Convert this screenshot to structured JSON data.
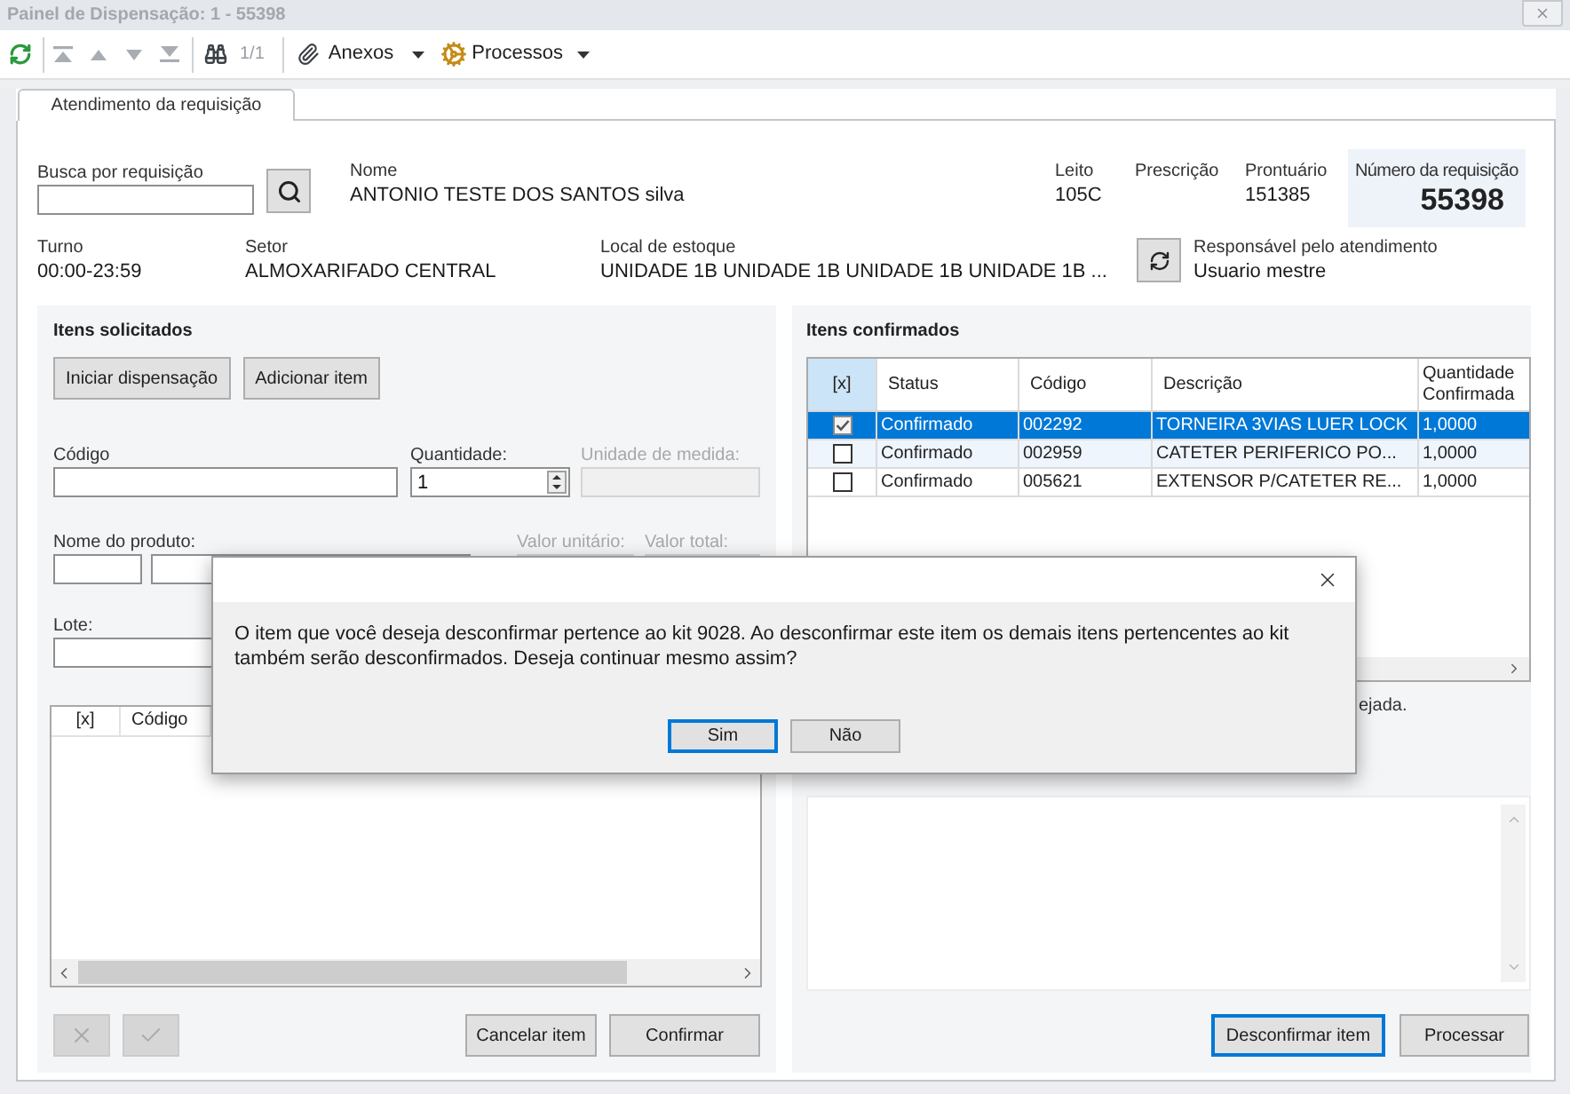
{
  "window": {
    "title": "Painel de Dispensação: 1 - 55398",
    "active": false
  },
  "toolbar": {
    "navigation": [
      {
        "kind": "first",
        "disabled": true
      },
      {
        "kind": "previous",
        "disabled": true
      },
      {
        "kind": "next",
        "disabled": true
      },
      {
        "kind": "last",
        "disabled": true
      }
    ],
    "record_counter": "1/1",
    "menus": [
      {
        "kind": "attachments",
        "label": "Anexos"
      },
      {
        "kind": "processes",
        "label": "Processos"
      }
    ]
  },
  "tabs": [
    {
      "label": "Atendimento da requisição",
      "selected": true
    }
  ],
  "request_header": {
    "search": {
      "label": "Busca por requisição"
    },
    "patient": {
      "label": "Nome",
      "value": "ANTONIO TESTE DOS SANTOS silva"
    },
    "bed": {
      "label": "Leito",
      "value": "105C"
    },
    "prescription": {
      "label": "Prescrição"
    },
    "medical_record": {
      "label": "Prontuário",
      "value": "151385"
    },
    "request_number": {
      "label": "Número da requisição",
      "value": "55398"
    },
    "shift": {
      "label": "Turno",
      "value": "00:00-23:59"
    },
    "sector": {
      "label": "Setor",
      "value": "ALMOXARIFADO CENTRAL"
    },
    "stock_location": {
      "label": "Local de estoque",
      "value": "UNIDADE 1B UNIDADE 1B UNIDADE 1B UNIDADE 1B ..."
    },
    "responsible": {
      "label": "Responsável pelo atendimento",
      "value": "Usuario mestre"
    }
  },
  "requested_items": {
    "title": "Itens solicitados",
    "actions": [
      {
        "label": "Iniciar dispensação"
      },
      {
        "label": "Adicionar item"
      }
    ],
    "form_rows": [
      [
        {
          "kind": "text",
          "label": "Código",
          "disabled": false
        },
        {
          "kind": "spin",
          "label": "Quantidade:",
          "value": "1",
          "disabled": false
        },
        {
          "kind": "text",
          "label": "Unidade de medida:",
          "disabled": true
        }
      ],
      [
        {
          "kind": "product",
          "label": "Nome do produto:",
          "disabled": false
        },
        {
          "kind": "text",
          "label": "Valor unitário:",
          "disabled": true
        },
        {
          "kind": "text",
          "label": "Valor total:",
          "disabled": true
        }
      ],
      [
        {
          "kind": "text",
          "label": "Lote:",
          "disabled": false
        }
      ]
    ],
    "table": {
      "columns": [
        "[x]",
        "Código"
      ]
    },
    "item_buttons": [
      {
        "kind": "cross",
        "disabled": true
      },
      {
        "kind": "tick",
        "disabled": true
      }
    ],
    "footer_buttons": [
      {
        "label": "Cancelar item",
        "focused": false
      },
      {
        "label": "Confirmar",
        "focused": false
      }
    ]
  },
  "confirmed_items": {
    "title": "Itens confirmados",
    "columns": [
      {
        "label": "[x]",
        "selected": true
      },
      {
        "label": "Status",
        "selected": false
      },
      {
        "label": "Código",
        "selected": false
      },
      {
        "label": "Descrição",
        "selected": false
      },
      {
        "label": "Quantidade Confirmada",
        "selected": false
      }
    ],
    "rows": [
      {
        "checked": true,
        "selected": true,
        "status": "Confirmado",
        "code": "002292",
        "description": "TORNEIRA 3VIAS LUER LOCK",
        "quantity": "1,0000"
      },
      {
        "checked": false,
        "selected": false,
        "status": "Confirmado",
        "code": "002959",
        "description": "CATETER PERIFERICO PO...",
        "quantity": "1,0000"
      },
      {
        "checked": false,
        "selected": false,
        "status": "Confirmado",
        "code": "005621",
        "description": "EXTENSOR P/CATETER RE...",
        "quantity": "1,0000"
      }
    ],
    "note": "ejada.",
    "footer_buttons": [
      {
        "label": "Desconfirmar item",
        "focused": true
      },
      {
        "label": "Processar",
        "focused": false
      }
    ]
  },
  "dialog": {
    "message": "O item que você deseja desconfirmar pertence ao kit 9028. Ao desconfirmar este item os demais itens pertencentes ao kit também serão desconfirmados. Deseja continuar mesmo assim?",
    "buttons": [
      {
        "label": "Sim",
        "focused": true
      },
      {
        "label": "Não",
        "focused": false
      }
    ]
  }
}
